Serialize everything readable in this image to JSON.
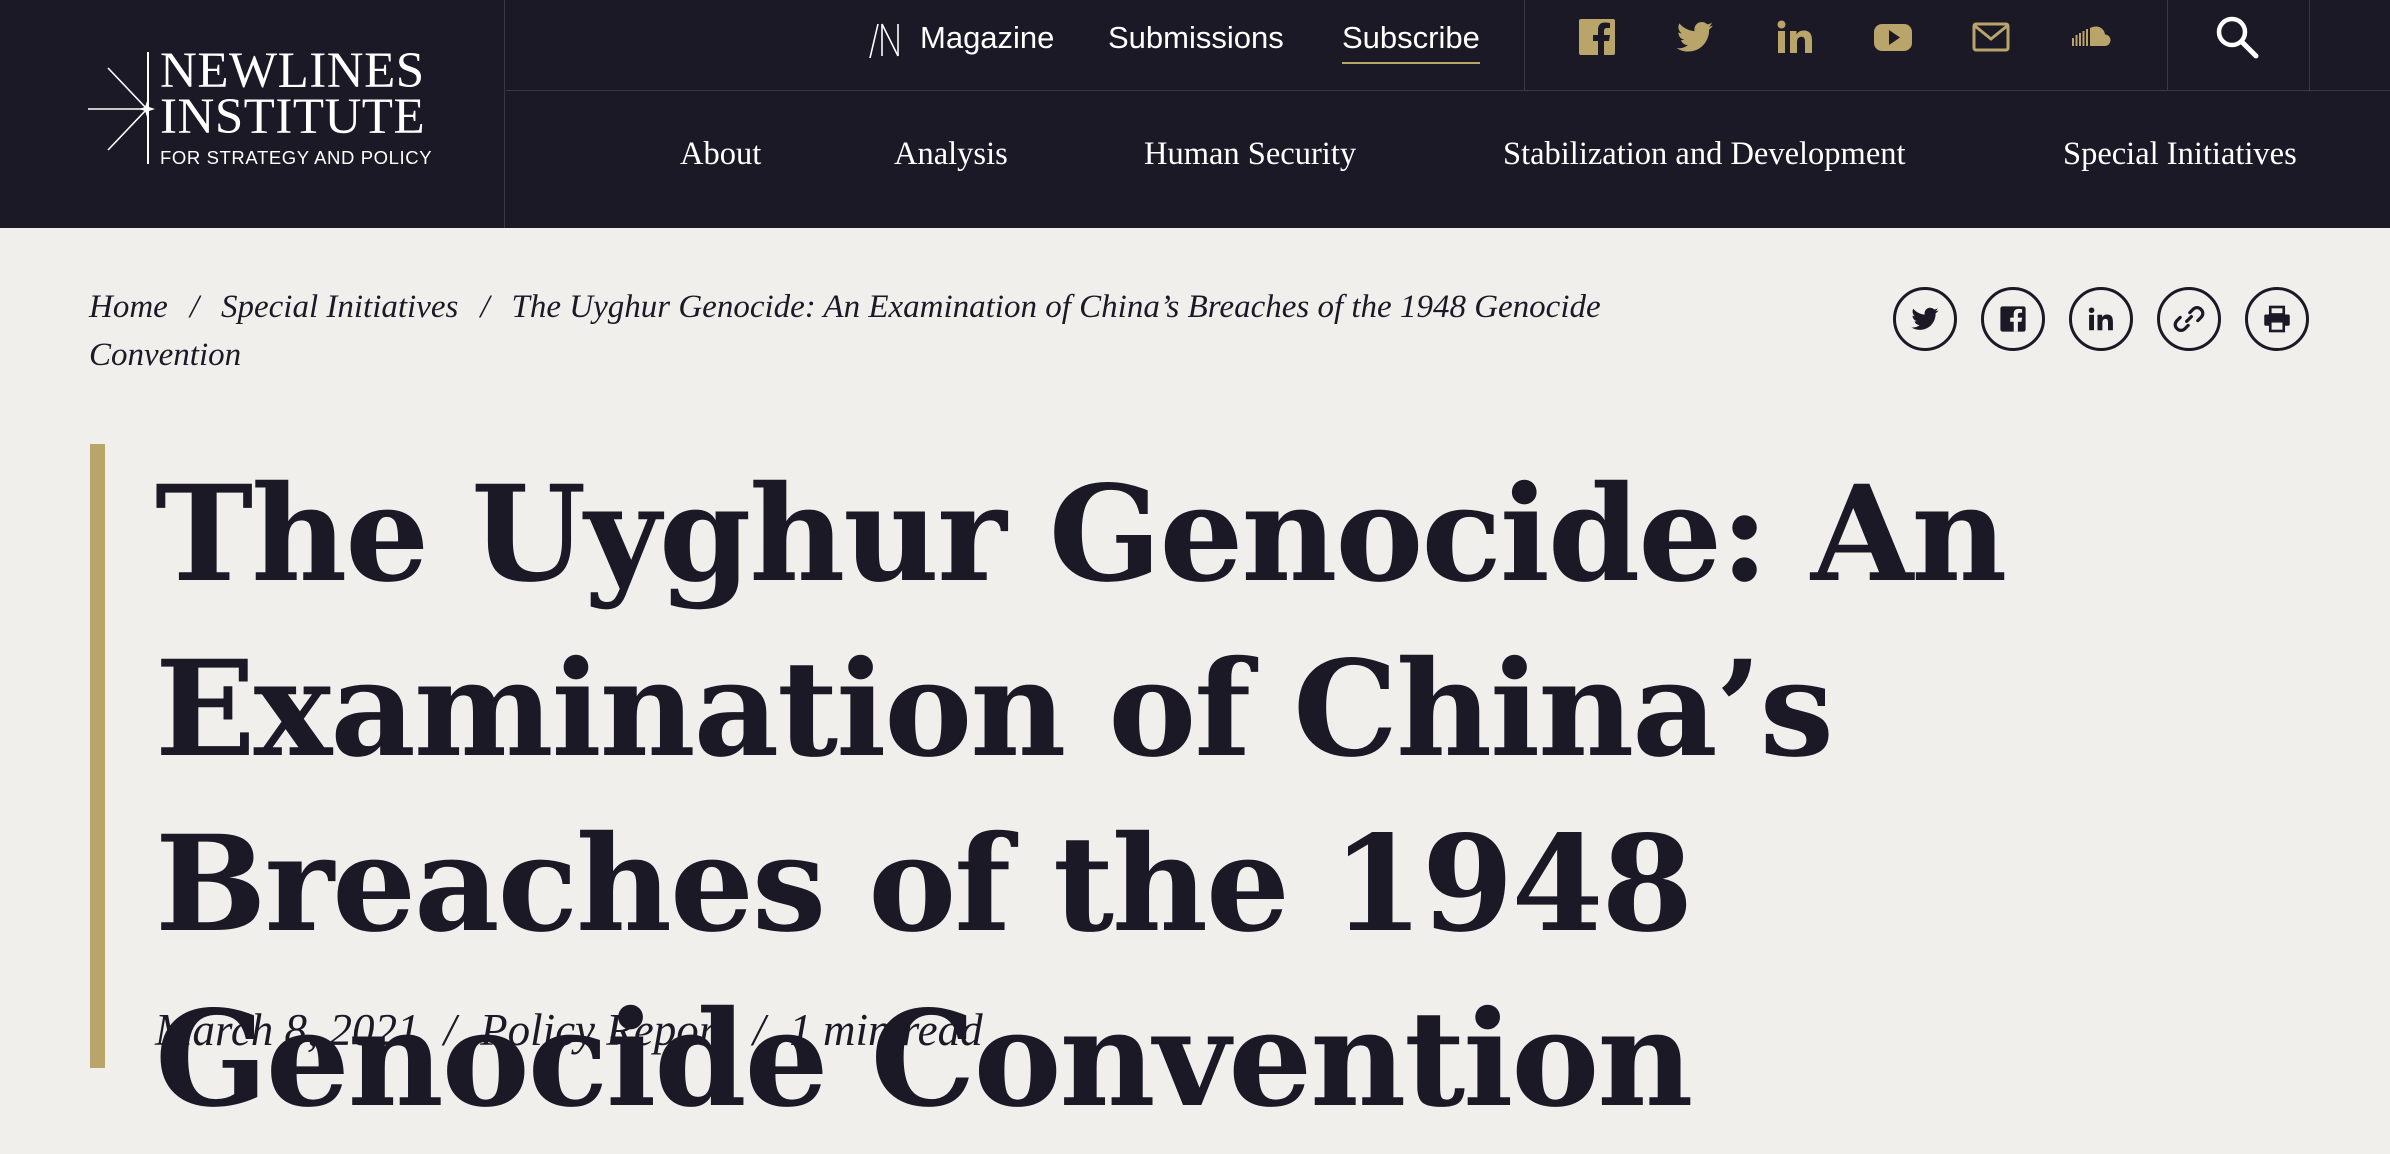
{
  "logo": {
    "line1": "NEWLINES",
    "line2": "INSTITUTE",
    "tagline": "FOR STRATEGY AND POLICY"
  },
  "top_nav": {
    "magazine": "Magazine",
    "submissions": "Submissions",
    "subscribe": "Subscribe"
  },
  "social_icons": [
    "facebook-icon",
    "twitter-icon",
    "linkedin-icon",
    "youtube-icon",
    "mail-icon",
    "soundcloud-icon"
  ],
  "main_nav": [
    "About",
    "Analysis",
    "Human Security",
    "Stabilization and Development",
    "Special Initiatives"
  ],
  "breadcrumb": {
    "home": "Home",
    "section": "Special Initiatives",
    "current": "The Uyghur Genocide: An Examination of China’s Breaches of the 1948 Genocide Convention",
    "separator": "/"
  },
  "share_icons": [
    "twitter-icon",
    "facebook-icon",
    "linkedin-icon",
    "link-icon",
    "print-icon"
  ],
  "article": {
    "title": "The Uyghur Genocide: An Examination of China’s Breaches of the 1948 Genocide Convention",
    "date": "March 8, 2021",
    "type": "Policy Report",
    "read_time": "1 min read",
    "separator": "/"
  },
  "colors": {
    "header_bg": "#1b1926",
    "page_bg": "#f0efec",
    "accent_gold": "#b9a46a",
    "text_dark": "#1b1926"
  }
}
